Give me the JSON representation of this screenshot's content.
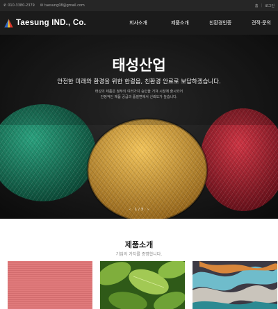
{
  "topbar": {
    "phone": "010-3380-2379",
    "email": "taesung08@gmail.com",
    "link_a": "홈",
    "separator": "|",
    "link_b": "로그인"
  },
  "header": {
    "logo_text": "Taesung IND., Co.",
    "nav": [
      "회사소개",
      "제품소개",
      "친환경인증",
      "견적·문의"
    ]
  },
  "hero": {
    "title": "태성산업",
    "subtitle": "안전한 미래와 환경을 위한 한걸음, 친환경 안료로 보답하겠습니다.",
    "desc_line1": "태성의 제품은 정부의 여러가지 승인을 거쳐 시장에 출시되어",
    "desc_line2": "안정적인 제품 공급과 품질면에서 신뢰도가 높습니다.",
    "yarn_colors": [
      "#157a5e",
      "#d9a440",
      "#a81f2c"
    ],
    "pager": {
      "prev": "‹",
      "status": "1 / 3",
      "next": "›"
    }
  },
  "products": {
    "title": "제품소개",
    "subtitle": "기업의 가치를 증명합니다.",
    "cards": [
      {
        "name": "pink-fabric-image",
        "color": "#e0797a"
      },
      {
        "name": "green-leaves-image",
        "color": "#5f8f2e"
      },
      {
        "name": "yarn-skeins-image",
        "color": "#6fb8c7"
      }
    ]
  }
}
